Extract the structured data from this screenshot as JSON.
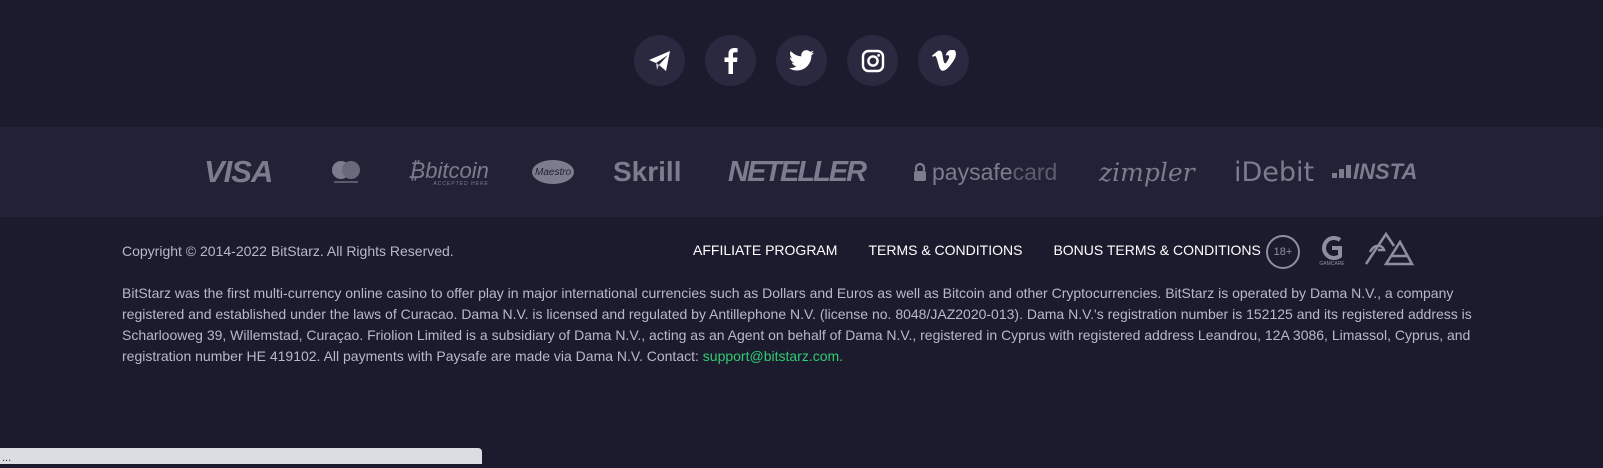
{
  "social": {
    "items": [
      {
        "name": "telegram-icon"
      },
      {
        "name": "facebook-icon"
      },
      {
        "name": "twitter-icon"
      },
      {
        "name": "instagram-icon"
      },
      {
        "name": "vimeo-icon"
      }
    ]
  },
  "payments": {
    "visa": "VISA",
    "bitcoin": "bitcoin",
    "bitcoin_sub": "ACCEPTED HERE",
    "maestro": "Maestro",
    "skrill": "Skrill",
    "neteller": "NETELLER",
    "paysafe_a": "paysafe",
    "paysafe_b": "card",
    "zimpler": "zimpler",
    "idebit": "iDebit",
    "insta": "INSTA"
  },
  "footer": {
    "copyright": "Copyright © 2014-2022 BitStarz. All Rights Reserved.",
    "links": {
      "affiliate": "AFFILIATE PROGRAM",
      "terms": "TERMS & CONDITIONS",
      "bonus_terms": "BONUS TERMS & CONDITIONS"
    },
    "age_badge": "18+",
    "gamcare": "GAMCARE",
    "disclaimer": "BitStarz was the first multi-currency online casino to offer play in major international currencies such as Dollars and Euros as well as Bitcoin and other Cryptocurrencies. BitStarz is operated by Dama N.V., a company registered and established under the laws of Curacao. Dama N.V. is licensed and regulated by Antillephone N.V. (license no. 8048/JAZ2020-013). Dama N.V.'s registration number is 152125 and its registered address is Scharlooweg 39, Willemstad, Curaçao. Friolion Limited is a subsidiary of Dama N.V., acting as an Agent on behalf of Dama N.V., registered in Cyprus with registered address Leandrou, 12A 3086, Limassol, Cyprus, and registration number HE 419102. All payments with Paysafe are made via Dama N.V. Contact: ",
    "contact_email": "support@bitstarz.com."
  },
  "status_bar": {
    "text": "..."
  },
  "colors": {
    "background": "#1c1b2e",
    "payments_band": "#222136",
    "social_button": "#2a2940",
    "link_accent": "#2ecc71"
  }
}
